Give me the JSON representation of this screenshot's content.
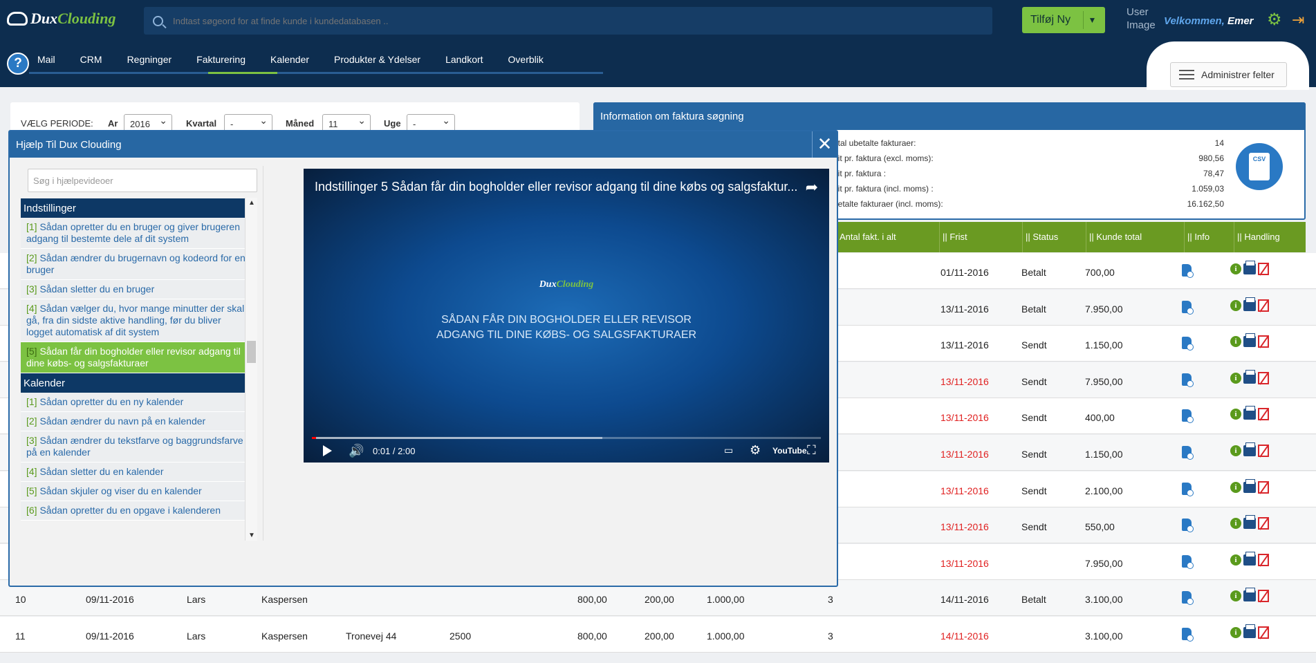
{
  "header": {
    "logo_a": "Dux",
    "logo_b": "Clouding",
    "search_placeholder": "Indtast søgeord for at finde kunde i kundedatabasen ..",
    "add_label": "Tilføj Ny",
    "user_image_alt": "User Image",
    "welcome_prefix": "Velkommen,",
    "welcome_name": "Emer",
    "gear_icon": "gear-icon",
    "logout_icon": "logout-icon"
  },
  "nav": {
    "help_label": "?",
    "items": [
      "Mail",
      "CRM",
      "Regninger",
      "Fakturering",
      "Kalender",
      "Produkter & Ydelser",
      "Landkort",
      "Overblik"
    ],
    "active": "Fakturering",
    "admin_label": "Administrer felter"
  },
  "period": {
    "label": "VÆLG PERIODE:",
    "ar_label": "Ar",
    "ar_value": "2016",
    "kvartal_label": "Kvartal",
    "kvartal_value": "-",
    "maaned_label": "Måned",
    "maaned_value": "11",
    "uge_label": "Uge",
    "uge_value": "-"
  },
  "info": {
    "title": "Information om faktura søgning",
    "rows": [
      {
        "label": "ntal ubetalte fakturaer:",
        "value": "14"
      },
      {
        "label": "nit pr. faktura (excl. moms):",
        "value": "980,56"
      },
      {
        "label": "nit pr. faktura :",
        "value": "78,47"
      },
      {
        "label": "nit pr. faktura (incl. moms) :",
        "value": "1.059,03"
      },
      {
        "label": "betalte fakturaer (incl. moms):",
        "value": "16.162,50"
      }
    ],
    "csv_label": "CSV"
  },
  "table": {
    "headers": [
      "Antal fakt. i alt",
      "|| Frist",
      "|| Status",
      "|| Kunde total",
      "|| Info",
      "|| Handling"
    ],
    "rows": [
      {
        "frist": "01/11-2016",
        "overdue": false,
        "status": "Betalt",
        "total": "700,00"
      },
      {
        "frist": "13/11-2016",
        "overdue": false,
        "status": "Betalt",
        "total": "7.950,00"
      },
      {
        "frist": "13/11-2016",
        "overdue": false,
        "status": "Sendt",
        "total": "1.150,00"
      },
      {
        "frist": "13/11-2016",
        "overdue": true,
        "status": "Sendt",
        "total": "7.950,00"
      },
      {
        "frist": "13/11-2016",
        "overdue": true,
        "status": "Sendt",
        "total": "400,00"
      },
      {
        "frist": "13/11-2016",
        "overdue": true,
        "status": "Sendt",
        "total": "1.150,00"
      },
      {
        "frist": "13/11-2016",
        "overdue": true,
        "status": "Sendt",
        "total": "2.100,00"
      },
      {
        "frist": "13/11-2016",
        "overdue": true,
        "status": "Sendt",
        "total": "550,00"
      },
      {
        "frist": "13/11-2016",
        "overdue": true,
        "status": "",
        "total": "7.950,00"
      }
    ],
    "full_rows": [
      {
        "nr": "10",
        "dato": "09/11-2016",
        "fornavn": "Lars",
        "efternavn": "Kaspersen",
        "adresse": "",
        "postnr": "",
        "beloeb": "800,00",
        "moms": "200,00",
        "ialt": "1.000,00",
        "antal": "3",
        "frist": "14/11-2016",
        "overdue": false,
        "status": "Betalt",
        "total": "3.100,00"
      },
      {
        "nr": "11",
        "dato": "09/11-2016",
        "fornavn": "Lars",
        "efternavn": "Kaspersen",
        "adresse": "Tronevej 44",
        "postnr": "2500",
        "beloeb": "800,00",
        "moms": "200,00",
        "ialt": "1.000,00",
        "antal": "3",
        "frist": "14/11-2016",
        "overdue": true,
        "status": "",
        "total": "3.100,00"
      }
    ]
  },
  "modal": {
    "title": "Hjælp Til Dux Clouding",
    "search_placeholder": "Søg i hjælpevideoer",
    "categories": [
      {
        "name": "Indstillinger",
        "items": [
          {
            "num": "[1]",
            "text": "Sådan opretter du en bruger og giver brugeren adgang til bestemte dele af dit system",
            "active": false
          },
          {
            "num": "[2]",
            "text": "Sådan ændrer du brugernavn og kodeord for en bruger",
            "active": false
          },
          {
            "num": "[3]",
            "text": "Sådan sletter du en bruger",
            "active": false
          },
          {
            "num": "[4]",
            "text": "Sådan vælger du, hvor mange minutter der skal gå, fra din sidste aktive handling, før du bliver logget automatisk af dit system",
            "active": false
          },
          {
            "num": "[5]",
            "text": "Sådan får din bogholder eller revisor adgang til dine købs- og salgsfakturaer",
            "active": true
          }
        ]
      },
      {
        "name": "Kalender",
        "items": [
          {
            "num": "[1]",
            "text": "Sådan opretter du en ny kalender",
            "active": false
          },
          {
            "num": "[2]",
            "text": "Sådan ændrer du navn på en kalender",
            "active": false
          },
          {
            "num": "[3]",
            "text": "Sådan ændrer du tekstfarve og baggrundsfarve på en kalender",
            "active": false
          },
          {
            "num": "[4]",
            "text": "Sådan sletter du en kalender",
            "active": false
          },
          {
            "num": "[5]",
            "text": "Sådan skjuler og viser du en kalender",
            "active": false
          },
          {
            "num": "[6]",
            "text": "Sådan opretter du en opgave i kalenderen",
            "active": false
          }
        ]
      }
    ],
    "video": {
      "title": "Indstillinger 5 Sådan får din bogholder eller revisor adgang til dine købs og salgsfaktur...",
      "logo_a": "Dux",
      "logo_b": "Clouding",
      "line1": "SÅDAN FÅR DIN BOGHOLDER ELLER REVISOR",
      "line2": "ADGANG TIL DINE KØBS- OG SALGSFAKTURAER",
      "time": "0:01 / 2:00",
      "played_fraction": 0.008,
      "youtube": "YouTube"
    }
  },
  "colors": {
    "header": "#0d2d4f",
    "accent": "#7cc242",
    "blue": "#2767a3",
    "overdue": "#e02020"
  }
}
